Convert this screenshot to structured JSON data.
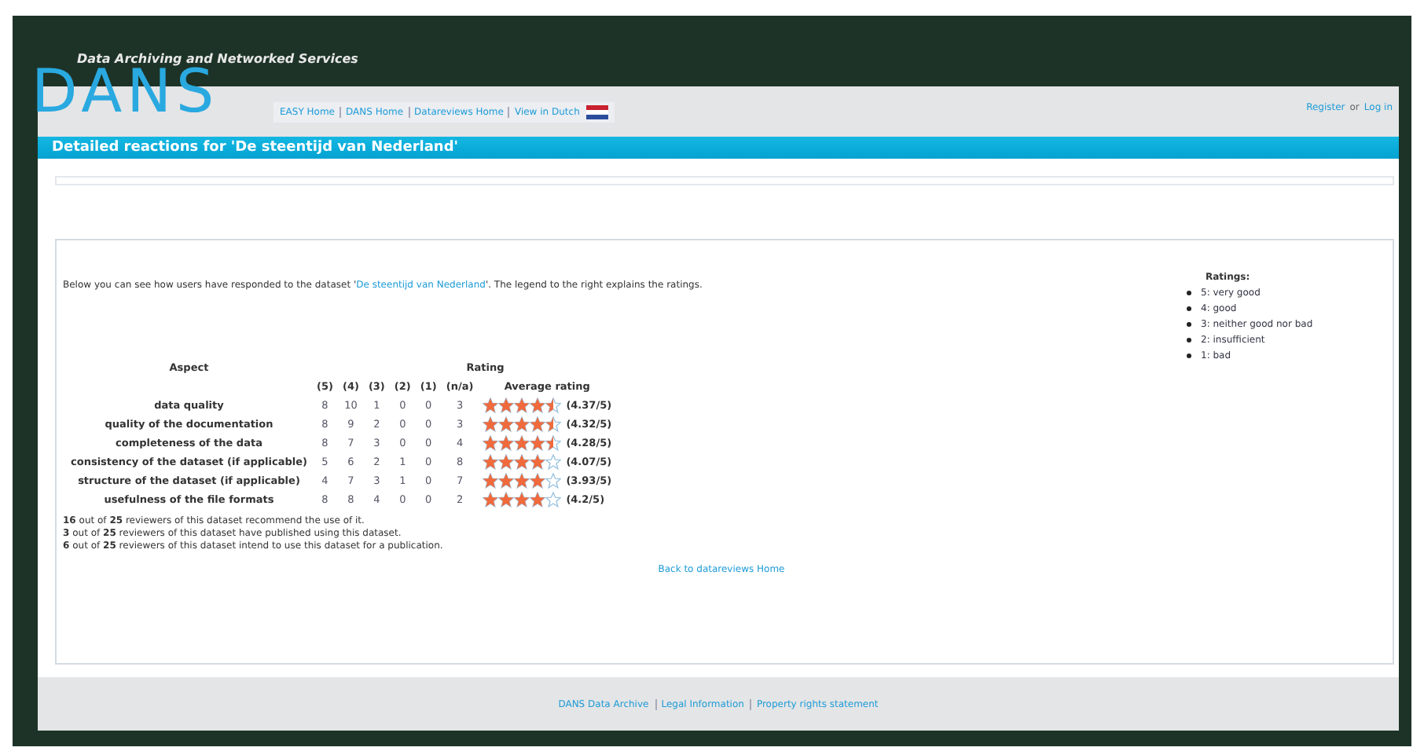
{
  "header": {
    "tagline": "Data Archiving and Networked Services",
    "logo": "DANS"
  },
  "nav": {
    "links": [
      "EASY Home",
      "DANS Home",
      "Datareviews Home",
      "View in Dutch"
    ],
    "account": [
      {
        "kind": "link",
        "text": "Register"
      },
      {
        "kind": "plain",
        "text": "or"
      },
      {
        "kind": "link",
        "text": "Log in"
      }
    ]
  },
  "title": "Detailed reactions for 'De steentijd van Nederland'",
  "intro": {
    "before": "Below you can see how users have responded to the dataset '",
    "link": "De steentijd van Nederland",
    "after": "'. The legend to the right explains the ratings."
  },
  "legend": {
    "title": "Ratings:",
    "items": [
      "5: very good",
      "4: good",
      "3: neither good nor bad",
      "2: insufficient",
      "1: bad"
    ]
  },
  "table": {
    "aspect_heading": "Aspect",
    "rating_heading": "Rating",
    "columns": [
      "(5)",
      "(4)",
      "(3)",
      "(2)",
      "(1)",
      "(n/a)",
      "Average rating"
    ],
    "rows": [
      {
        "aspect": "data quality",
        "counts": [
          "8",
          "10",
          "1",
          "0",
          "0",
          "3"
        ],
        "stars": 4.5,
        "average": "(4.37/5)"
      },
      {
        "aspect": "quality of the documentation",
        "counts": [
          "8",
          "9",
          "2",
          "0",
          "0",
          "3"
        ],
        "stars": 4.5,
        "average": "(4.32/5)"
      },
      {
        "aspect": "completeness of the data",
        "counts": [
          "8",
          "7",
          "3",
          "0",
          "0",
          "4"
        ],
        "stars": 4.5,
        "average": "(4.28/5)"
      },
      {
        "aspect": "consistency of the dataset (if applicable)",
        "counts": [
          "5",
          "6",
          "2",
          "1",
          "0",
          "8"
        ],
        "stars": 4,
        "average": "(4.07/5)"
      },
      {
        "aspect": "structure of the dataset (if applicable)",
        "counts": [
          "4",
          "7",
          "3",
          "1",
          "0",
          "7"
        ],
        "stars": 4,
        "average": "(3.93/5)"
      },
      {
        "aspect": "usefulness of the file formats",
        "counts": [
          "8",
          "8",
          "4",
          "0",
          "0",
          "2"
        ],
        "stars": 4,
        "average": "(4.2/5)"
      }
    ]
  },
  "summary": [
    "**16** out of **25** reviewers of this dataset recommend the use of it.",
    "**3** out of **25** reviewers of this dataset have published using this dataset.",
    "**6** out of **25** reviewers of this dataset intend to use this dataset for a publication."
  ],
  "back_link": "Back to datareviews Home",
  "footer": [
    "DANS Data Archive",
    "Legal Information",
    "Property rights statement"
  ]
}
